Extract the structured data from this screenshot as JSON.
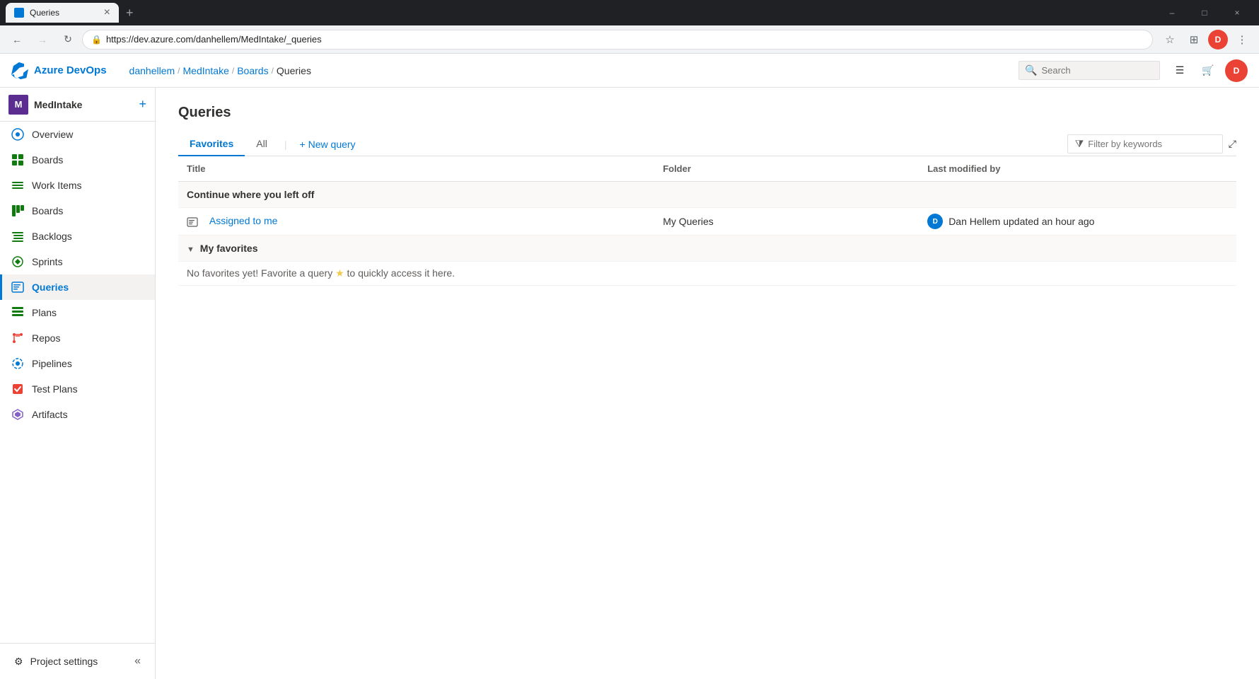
{
  "browser": {
    "tab_title": "Queries",
    "tab_favicon": "Q",
    "new_tab_label": "+",
    "url": "https://dev.azure.com/danhellem/MedIntake/_queries",
    "nav_back_disabled": false,
    "nav_forward_disabled": true,
    "window_controls": [
      "–",
      "□",
      "×"
    ]
  },
  "header": {
    "logo_text": "Azure DevOps",
    "search_placeholder": "Search",
    "breadcrumb": [
      {
        "label": "danhellem",
        "href": "#"
      },
      {
        "label": "MedIntake",
        "href": "#"
      },
      {
        "label": "Boards",
        "href": "#"
      },
      {
        "label": "Queries",
        "href": "#"
      }
    ]
  },
  "sidebar": {
    "project_name": "MedIntake",
    "project_avatar": "M",
    "items": [
      {
        "id": "overview",
        "label": "Overview",
        "icon": "○"
      },
      {
        "id": "boards",
        "label": "Boards",
        "icon": "▦"
      },
      {
        "id": "work-items",
        "label": "Work Items",
        "icon": "☰"
      },
      {
        "id": "boards2",
        "label": "Boards",
        "icon": "⊞"
      },
      {
        "id": "backlogs",
        "label": "Backlogs",
        "icon": "≡"
      },
      {
        "id": "sprints",
        "label": "Sprints",
        "icon": "◫"
      },
      {
        "id": "queries",
        "label": "Queries",
        "icon": "⊟",
        "active": true
      },
      {
        "id": "plans",
        "label": "Plans",
        "icon": "▤"
      },
      {
        "id": "repos",
        "label": "Repos",
        "icon": "⑂"
      },
      {
        "id": "pipelines",
        "label": "Pipelines",
        "icon": "⚙"
      },
      {
        "id": "test-plans",
        "label": "Test Plans",
        "icon": "✓"
      },
      {
        "id": "artifacts",
        "label": "Artifacts",
        "icon": "◈"
      }
    ],
    "settings_label": "Project settings",
    "collapse_label": "«"
  },
  "page": {
    "title": "Queries",
    "tabs": [
      {
        "id": "favorites",
        "label": "Favorites",
        "active": true
      },
      {
        "id": "all",
        "label": "All",
        "active": false
      }
    ],
    "new_query_label": "+ New query",
    "filter_placeholder": "Filter by keywords",
    "expand_icon": "⤢",
    "table_headers": {
      "title": "Title",
      "folder": "Folder",
      "last_modified": "Last modified by"
    },
    "sections": [
      {
        "id": "continue",
        "title": "Continue where you left off",
        "collapsible": false,
        "rows": [
          {
            "title": "Assigned to me",
            "folder": "My Queries",
            "updated_by_avatar": "D",
            "updated_by_text": "Dan Hellem updated an hour ago"
          }
        ]
      },
      {
        "id": "my-favorites",
        "title": "My favorites",
        "collapsible": true,
        "collapsed": false,
        "rows": [],
        "empty_message": "No favorites yet! Favorite a query",
        "empty_star": "★",
        "empty_suffix": "to quickly access it here."
      }
    ]
  }
}
